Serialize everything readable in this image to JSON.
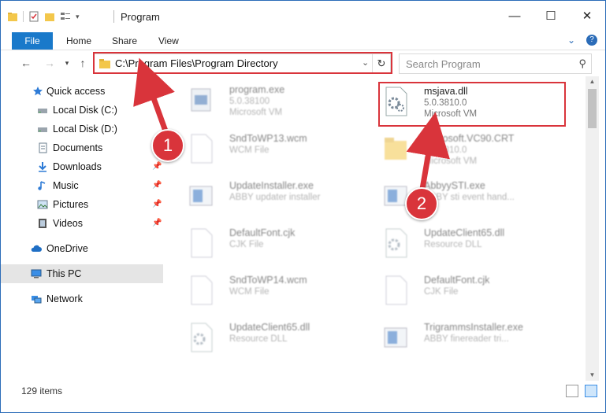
{
  "window": {
    "title": "Program",
    "controls": {
      "minimize": "—",
      "maximize": "☐",
      "close": "✕"
    }
  },
  "ribbon": {
    "tabs": [
      "File",
      "Home",
      "Share",
      "View"
    ],
    "expand_icon": "⌄",
    "help_icon": "?"
  },
  "navbar": {
    "address": "C:\\Program Files\\Program Directory",
    "search_placeholder": "Search Program"
  },
  "sidebar": {
    "items": [
      {
        "label": "Quick access",
        "icon": "star-icon",
        "pinned": false
      },
      {
        "label": "Local Disk (C:)",
        "icon": "drive-icon",
        "pinned": false
      },
      {
        "label": "Local Disk (D:)",
        "icon": "drive-icon",
        "pinned": false
      },
      {
        "label": "Documents",
        "icon": "documents-icon",
        "pinned": false
      },
      {
        "label": "Downloads",
        "icon": "download-icon",
        "pinned": true
      },
      {
        "label": "Music",
        "icon": "music-icon",
        "pinned": true
      },
      {
        "label": "Pictures",
        "icon": "pictures-icon",
        "pinned": true
      },
      {
        "label": "Videos",
        "icon": "videos-icon",
        "pinned": true
      },
      {
        "label": "OneDrive",
        "icon": "cloud-icon",
        "pinned": false
      },
      {
        "label": "This PC",
        "icon": "computer-icon",
        "pinned": false
      },
      {
        "label": "Network",
        "icon": "network-icon",
        "pinned": false
      }
    ]
  },
  "files": [
    {
      "name": "program.exe",
      "line2": "5.0.38100",
      "line3": "Microsoft VM"
    },
    {
      "name": "msjava.dll",
      "line2": "5.0.3810.0",
      "line3": "Microsoft VM"
    },
    {
      "name": "SndToWP13.wcm",
      "line2": "WCM File",
      "line3": ""
    },
    {
      "name": "Microsoft.VC90.CRT",
      "line2": "5.0.3810.0",
      "line3": "Microsoft VM"
    },
    {
      "name": "UpdateInstaller.exe",
      "line2": "ABBY updater installer",
      "line3": ""
    },
    {
      "name": "AbbyySTI.exe",
      "line2": "ABBY sti event hand...",
      "line3": ""
    },
    {
      "name": "DefaultFont.cjk",
      "line2": "CJK File",
      "line3": ""
    },
    {
      "name": "UpdateClient65.dll",
      "line2": "Resource DLL",
      "line3": ""
    },
    {
      "name": "SndToWP14.wcm",
      "line2": "WCM File",
      "line3": ""
    },
    {
      "name": "DefaultFont.cjk",
      "line2": "CJK File",
      "line3": ""
    },
    {
      "name": "UpdateClient65.dll",
      "line2": "Resource DLL",
      "line3": ""
    },
    {
      "name": "TrigrammsInstaller.exe",
      "line2": "ABBY finereader tri...",
      "line3": ""
    }
  ],
  "status": {
    "item_count": "129 items"
  },
  "annotations": {
    "step1": "1",
    "step2": "2",
    "color": "#d9343b"
  }
}
